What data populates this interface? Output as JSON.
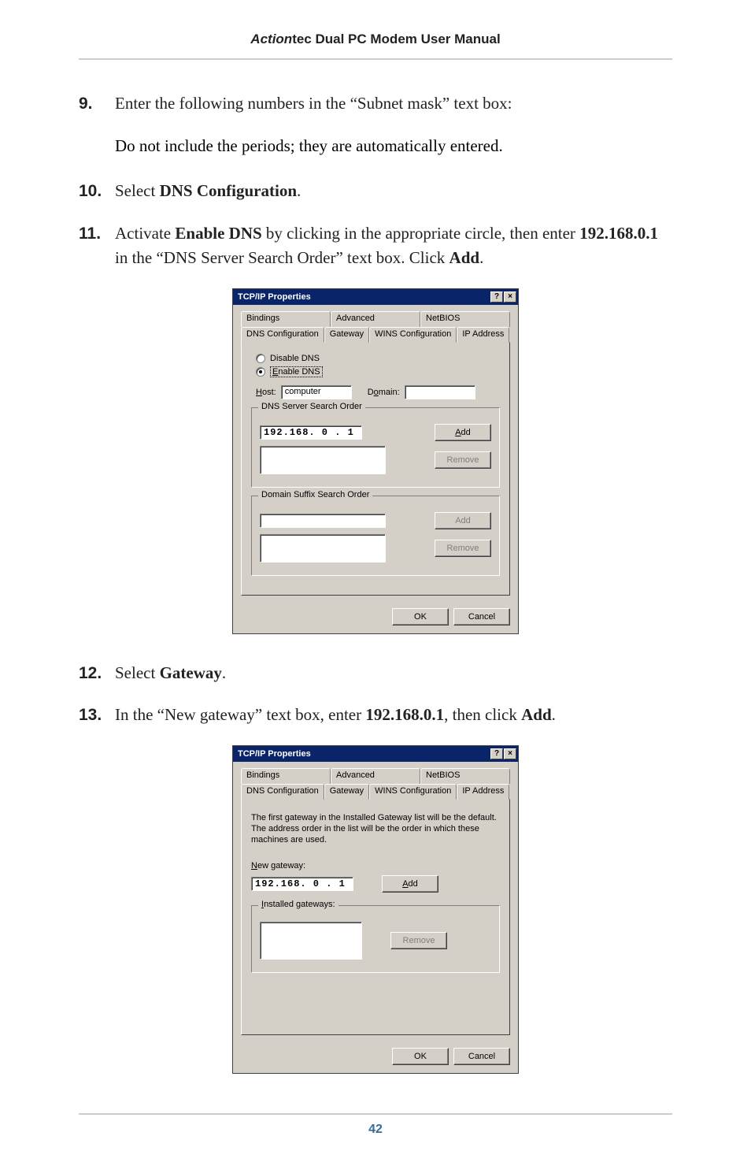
{
  "header": {
    "brand_italic": "Action",
    "brand_rest": "tec",
    "title_rest": " Dual PC Modem User Manual"
  },
  "steps": {
    "s9": {
      "num": "9.",
      "text": "Enter the following numbers in the “Subnet mask” text box:"
    },
    "s9b": {
      "text": "Do not include the periods; they are automatically entered."
    },
    "s10": {
      "num": "10.",
      "pre": "Select ",
      "bold": "DNS Configuration",
      "post": "."
    },
    "s11": {
      "num": "11.",
      "pre": "Activate ",
      "bold1": "Enable DNS",
      "mid": " by clicking in the appropriate circle, then enter ",
      "bold2": "192.168.0.1",
      "post1": " in the “DNS Server Search Order” text box. Click ",
      "bold3": "Add",
      "post2": "."
    },
    "s12": {
      "num": "12.",
      "pre": "Select ",
      "bold": "Gateway",
      "post": "."
    },
    "s13": {
      "num": "13.",
      "pre": "In the “New gateway” text box, enter ",
      "bold1": "192.168.0.1",
      "mid": ", then click ",
      "bold2": "Add",
      "post": "."
    }
  },
  "dialog_common": {
    "title": "TCP/IP Properties",
    "help_btn": "?",
    "close_btn": "×",
    "tabs_back": {
      "bindings": "Bindings",
      "advanced": "Advanced",
      "netbios": "NetBIOS"
    },
    "tabs_front": {
      "dnsconf": "DNS Configuration",
      "gateway": "Gateway",
      "winsconf": "WINS Configuration",
      "ipaddr": "IP Address"
    },
    "ok": "OK",
    "cancel": "Cancel"
  },
  "dns_dialog": {
    "disable_label": "Disable DNS",
    "enable_pre_u": "E",
    "enable_rest": "nable DNS",
    "host_pre_u": "H",
    "host_rest": "ost:",
    "host_value": "computer",
    "domain_label": "Domain:",
    "domain_pre": "D",
    "domain_u": "o",
    "domain_rest": "main:",
    "search_order": "DNS Server Search Order",
    "ip_value": "192.168. 0 . 1",
    "add_u": "A",
    "add_rest": "dd",
    "remove": "Remove",
    "suffix_order": "Domain Suffix Search Order",
    "add2": "Add",
    "remove2": "Remove"
  },
  "gw_dialog": {
    "desc": "The first gateway in the Installed Gateway list will be the default. The address order in the list will be the order in which these machines are used.",
    "new_gw_u": "N",
    "new_gw_rest": "ew gateway:",
    "ip_value": "192.168. 0 . 1",
    "add_u": "A",
    "add_rest": "dd",
    "installed_u": "I",
    "installed_rest": "nstalled gateways:",
    "remove": "Remove"
  },
  "footer": {
    "page": "42"
  }
}
